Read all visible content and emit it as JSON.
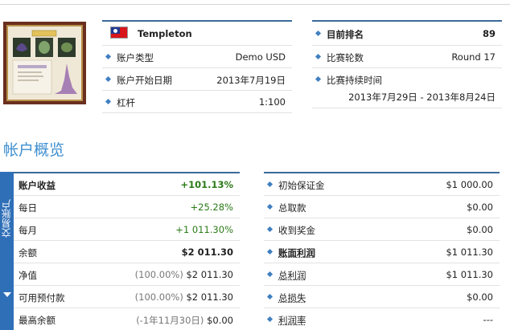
{
  "account": {
    "name": "Templeton",
    "flag_icon": "taiwan-flag-icon",
    "rows": [
      {
        "label": "账户类型",
        "value": "Demo USD"
      },
      {
        "label": "账户开始日期",
        "value": "2013年7月19日"
      },
      {
        "label": "杠杆",
        "value": "1:100"
      }
    ]
  },
  "contest": {
    "rank_label": "目前排名",
    "rank_value": "89",
    "round_label": "比赛轮数",
    "round_value": "Round 17",
    "duration_label": "比赛持续时间",
    "duration_value": "2013年7月29日 - 2013年8月24日"
  },
  "overview": {
    "title": "帐户概览",
    "sidebar_label": "交易账户",
    "left": [
      {
        "label": "账户收益",
        "pct": "",
        "value": "+101.13%"
      },
      {
        "label": "每日",
        "pct": "",
        "value": "+25.28%"
      },
      {
        "label": "每月",
        "pct": "",
        "value": "+1 011.30%"
      },
      {
        "label": "余额",
        "pct": "",
        "value": "$2 011.30"
      },
      {
        "label": "净值",
        "pct": "(100.00%)",
        "value": "$2 011.30"
      },
      {
        "label": "可用预付款",
        "pct": "(100.00%)",
        "value": "$2 011.30"
      },
      {
        "label": "最高余额",
        "pct": "(-1年11月30日)",
        "value": "$0.00"
      }
    ],
    "right": [
      {
        "label": "初始保证金",
        "value": "$1 000.00"
      },
      {
        "label": "总取款",
        "value": "$0.00"
      },
      {
        "label": "收到奖金",
        "value": "$0.00"
      },
      {
        "label": "账面利润",
        "value": "$1 011.30"
      },
      {
        "label": "总利润",
        "value": "$1 011.30"
      },
      {
        "label": "总损失",
        "value": "$0.00"
      },
      {
        "label": "利润率",
        "value": "---"
      }
    ]
  },
  "colors": {
    "accent": "#3a6a9a",
    "green": "#2a7a16",
    "sidebar": "#2f6fb8"
  }
}
